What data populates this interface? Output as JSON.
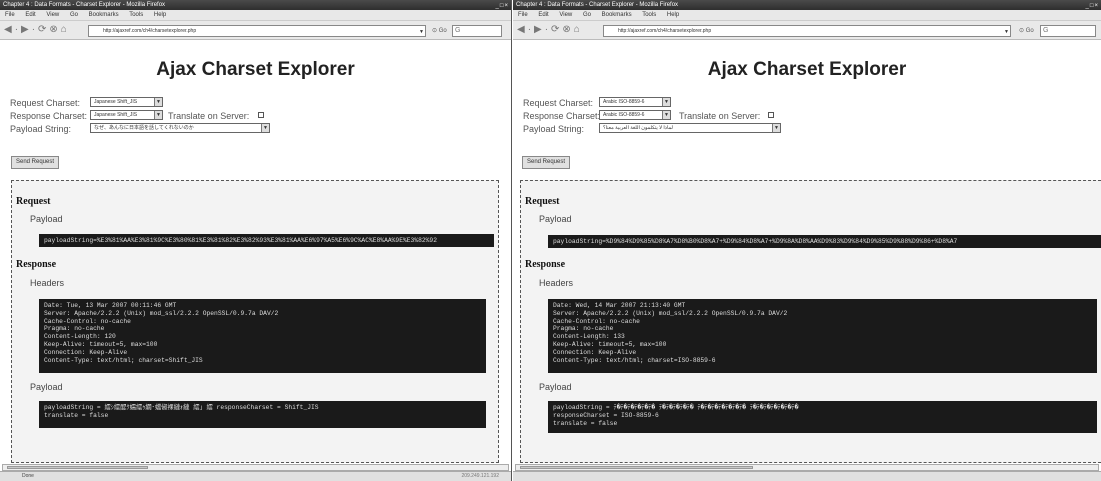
{
  "left": {
    "window_title": "Chapter 4 : Data Formats - Charset Explorer - Mozilla Firefox",
    "menu": [
      "File",
      "Edit",
      "View",
      "Go",
      "Bookmarks",
      "Tools",
      "Help"
    ],
    "url": "http://ajaxref.com/ch4/charsetexplorer.php",
    "go_label": "Go",
    "search_placeholder": "G",
    "page_title": "Ajax Charset Explorer",
    "request_charset_label": "Request Charset:",
    "request_charset_value": "Japanese Shift_JIS",
    "response_charset_label": "Response Charset:",
    "response_charset_value": "Japanese Shift_JIS",
    "translate_label": "Translate on Server:",
    "payload_string_label": "Payload String:",
    "payload_string_value": "なぜ、あんなに日本語を話してくれないのか",
    "send_button": "Send Request",
    "request_heading": "Request",
    "request_payload_label": "Payload",
    "request_payload": "payloadString=%E3%81%AA%E3%81%9C%E3%80%81%E3%81%82%E3%82%93%E3%81%AA%E6%97%A5%E6%9C%AC%E8%AA%9E%E3%82%92",
    "response_heading": "Response",
    "headers_label": "Headers",
    "headers": "Date: Tue, 13 Mar 2007 00:11:46 GMT\nServer: Apache/2.2.2 (Unix) mod_ssl/2.2.2 OpenSSL/0.9.7a DAV/2\nCache-Control: no-cache\nPragma: no-cache\nContent-Length: 120\nKeep-Alive: timeout=5, max=100\nConnection: Keep-Alive\nContent-Type: text/html; charset=Shift_JIS",
    "response_payload_label": "Payload",
    "response_payload": "payloadString = 繧ｼ繧醍ｸ蠕繧ｩ繝･蟷俶裸縺ｫ縺 繧｣ 繧 responseCharset = Shift_JIS\ntranslate = false",
    "status_text": "Done",
    "status_right": "209.249.121.192"
  },
  "right": {
    "window_title": "Chapter 4 : Data Formats - Charset Explorer - Mozilla Firefox",
    "menu": [
      "File",
      "Edit",
      "View",
      "Go",
      "Bookmarks",
      "Tools",
      "Help"
    ],
    "url": "http://ajaxref.com/ch4/charsetexplorer.php",
    "go_label": "Go",
    "search_placeholder": "G",
    "page_title": "Ajax Charset Explorer",
    "request_charset_label": "Request Charset:",
    "request_charset_value": "Arabic ISO-8859-6",
    "response_charset_label": "Response Charset:",
    "response_charset_value": "Arabic ISO-8859-6",
    "translate_label": "Translate on Server:",
    "payload_string_label": "Payload String:",
    "payload_string_value": "لماذا لا يتكلمون اللغة العربية معنا؟",
    "send_button": "Send Request",
    "request_heading": "Request",
    "request_payload_label": "Payload",
    "request_payload": "payloadString=%D9%84%D9%85%D8%A7%D8%B0%D8%A7+%D9%84%D8%A7+%D9%8A%D8%AA%D9%83%D9%84%D9%85%D9%88%D9%86+%D8%A7",
    "response_heading": "Response",
    "headers_label": "Headers",
    "headers": "Date: Wed, 14 Mar 2007 21:13:40 GMT\nServer: Apache/2.2.2 (Unix) mod_ssl/2.2.2 OpenSSL/0.9.7a DAV/2\nCache-Control: no-cache\nPragma: no-cache\nContent-Length: 133\nKeep-Alive: timeout=5, max=100\nConnection: Keep-Alive\nContent-Type: text/html; charset=ISO-8859-6",
    "response_payload_label": "Payload",
    "response_payload": "payloadString = ﾃ�ﾃ�ﾃ�ﾃ�ﾃ�ﾃ� ﾃ�ﾃ�ﾃ�ﾃ�ﾃ� ﾃ�ﾃ�ﾃ�ﾃ�ﾃ�ﾃ�ﾃ� ﾃ�ﾃ�ﾃ�ﾃ�ﾃ�ﾃ�ﾃ�\nresponseCharset = ISO-8859-6\ntranslate = false",
    "status_text": "",
    "status_right": ""
  }
}
